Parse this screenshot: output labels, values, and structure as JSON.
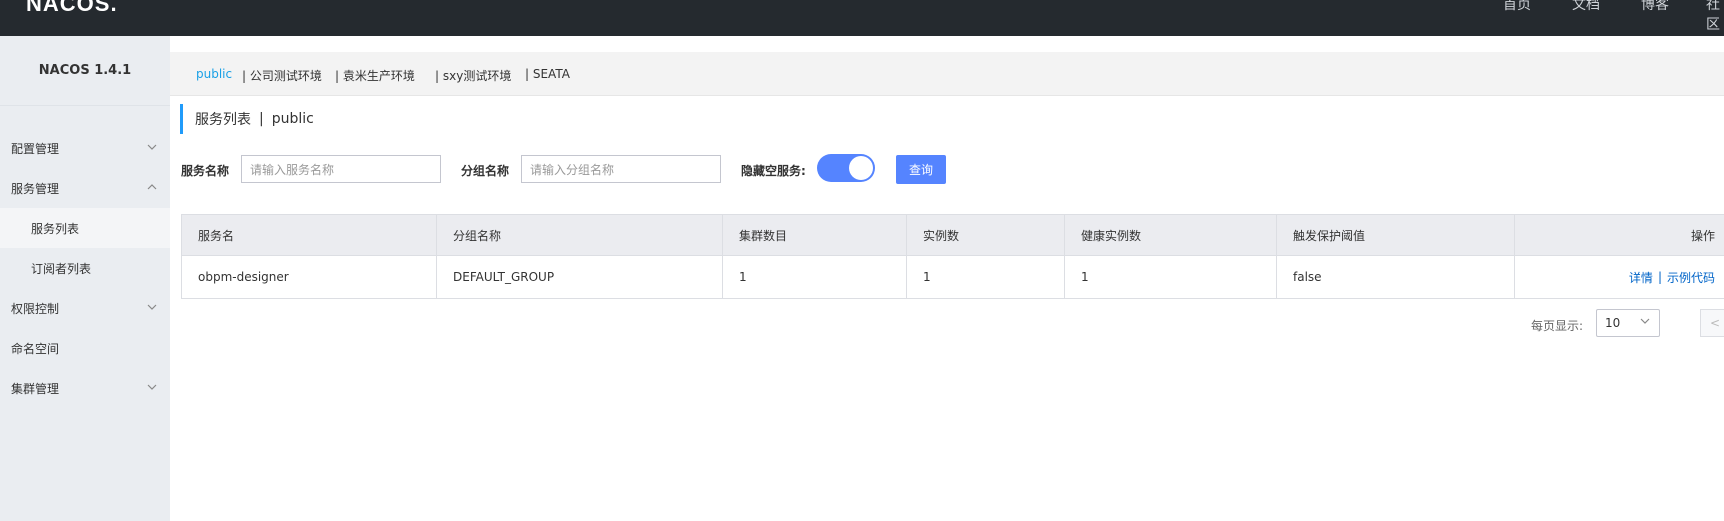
{
  "topbar": {
    "logo": "NACOS.",
    "nav": [
      "首页",
      "文档",
      "博客",
      "社区"
    ]
  },
  "sidebar": {
    "title": "NACOS 1.4.1",
    "items": [
      {
        "label": "配置管理",
        "icon": "chevron-down-icon"
      },
      {
        "label": "服务管理",
        "icon": "chevron-up-icon"
      },
      {
        "label": "服务列表",
        "sub": true,
        "active": true
      },
      {
        "label": "订阅者列表",
        "sub": true
      },
      {
        "label": "权限控制",
        "icon": "chevron-down-icon"
      },
      {
        "label": "命名空间"
      },
      {
        "label": "集群管理",
        "icon": "chevron-down-icon"
      }
    ]
  },
  "namespaces": {
    "items": [
      "public",
      "| 公司测试环境",
      "| 袁米生产环境",
      "| sxy测试环境",
      "| SEATA"
    ],
    "active": "public"
  },
  "page": {
    "title": "服务列表",
    "sep": "|",
    "namespace": "public"
  },
  "filters": {
    "service_name_label": "服务名称",
    "service_name_placeholder": "请输入服务名称",
    "group_name_label": "分组名称",
    "group_name_placeholder": "请输入分组名称",
    "hide_empty_label": "隐藏空服务:",
    "hide_empty_on": true,
    "query_button": "查询"
  },
  "table": {
    "headers": [
      "服务名",
      "分组名称",
      "集群数目",
      "实例数",
      "健康实例数",
      "触发保护阈值",
      "操作"
    ],
    "rows": [
      {
        "service": "obpm-designer",
        "group": "DEFAULT_GROUP",
        "clusters": "1",
        "instances": "1",
        "healthy": "1",
        "threshold": "false",
        "action_detail": "详情",
        "action_sep": "|",
        "action_code": "示例代码"
      }
    ]
  },
  "pagination": {
    "page_size_label": "每页显示:",
    "page_size": "10",
    "prev": "<"
  },
  "colors": {
    "topbar": "#252a2f",
    "accent": "#5584ff",
    "link": "#0064c8",
    "ns_active": "#1aa0e6"
  }
}
